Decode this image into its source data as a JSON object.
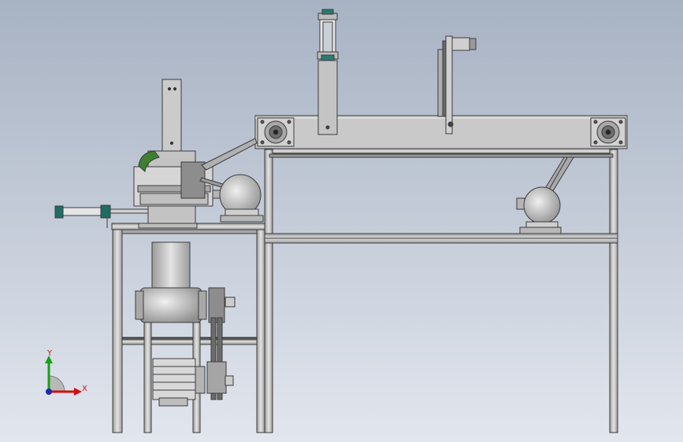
{
  "scene": {
    "background_top": "#a9b4c4",
    "background_bottom": "#dfe4ec",
    "metal": "#c8c8c8",
    "metal_dark": "#8a8a8a",
    "edge": "#3c3c3c",
    "flange_green": "#3a7a30",
    "cylinder_cap": "#1f6d64"
  },
  "triad": {
    "x_label": "X",
    "y_label": "Y",
    "x_color": "#d01010",
    "y_color": "#18a018",
    "z_color": "#1a2ab0"
  }
}
